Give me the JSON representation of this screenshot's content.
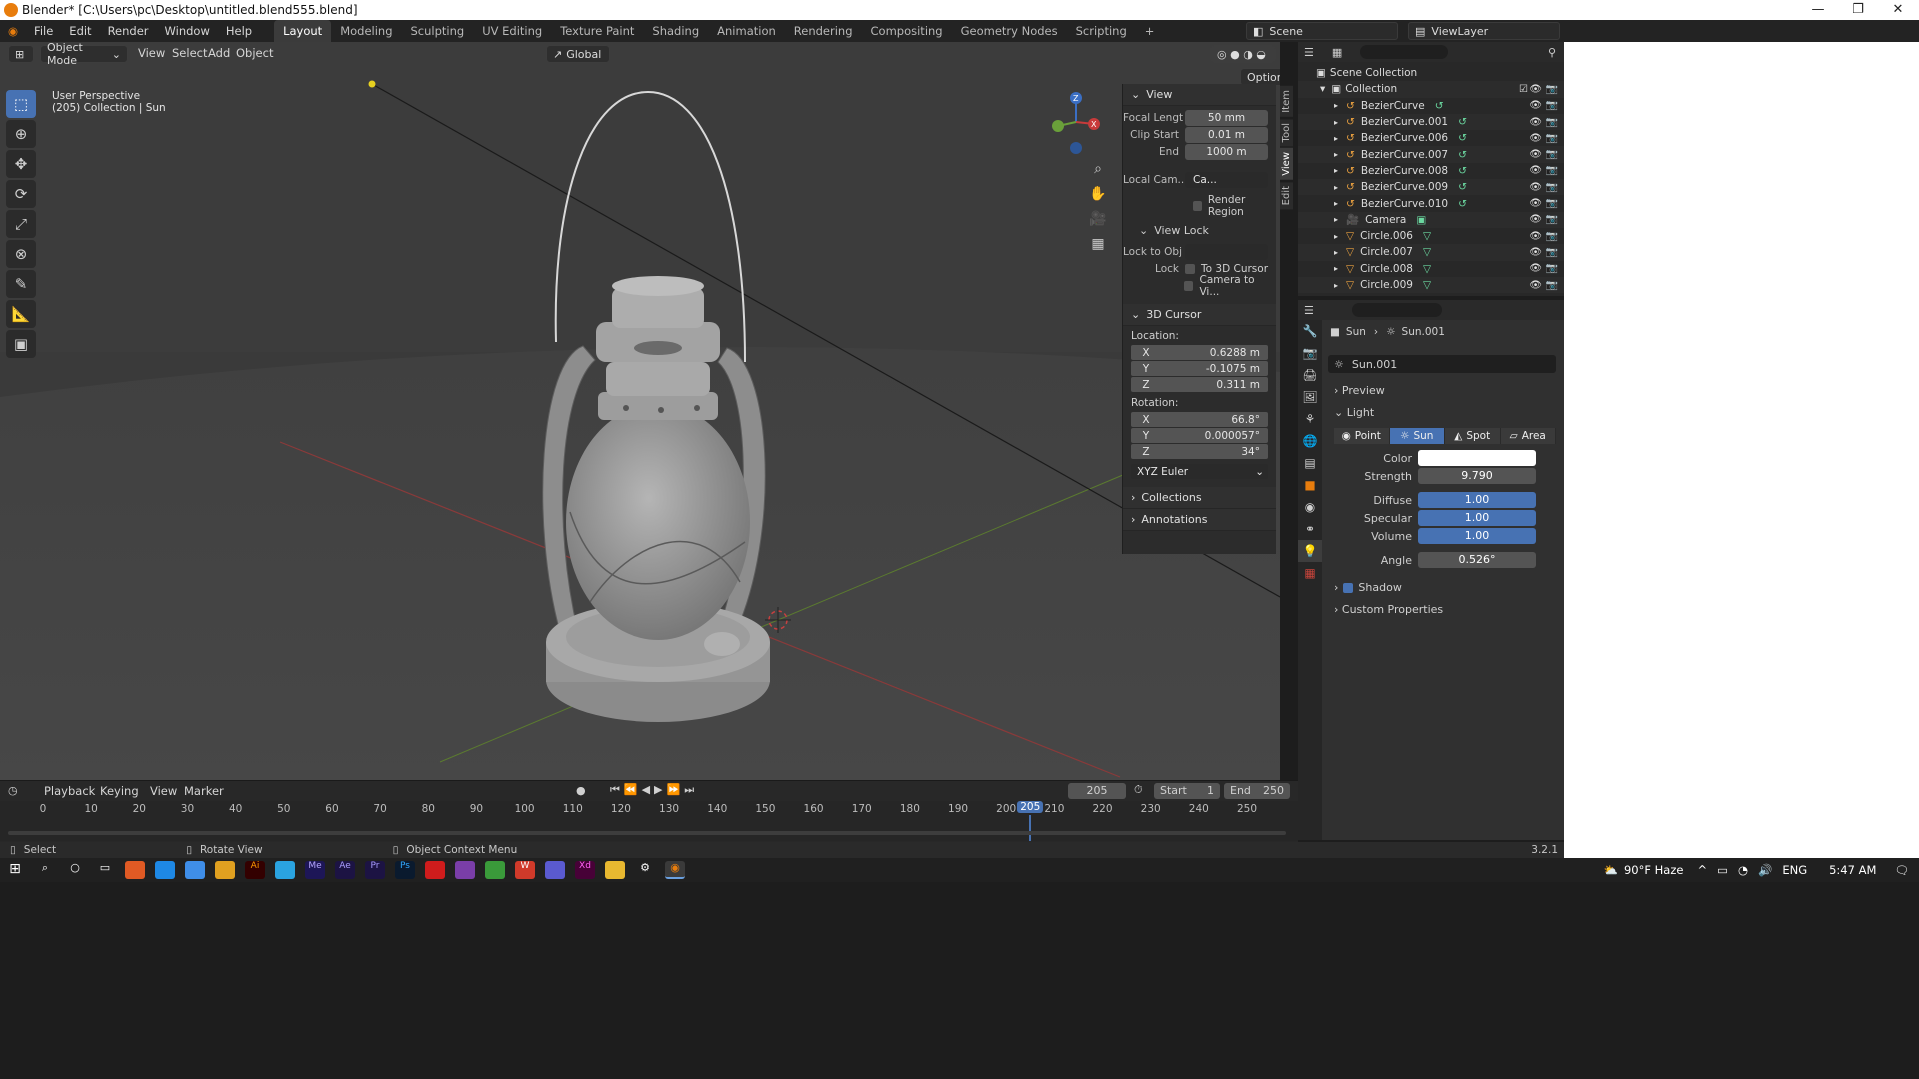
{
  "window": {
    "title": "Blender* [C:\\Users\\pc\\Desktop\\untitled.blend555.blend]"
  },
  "menu": [
    "File",
    "Edit",
    "Render",
    "Window",
    "Help"
  ],
  "workspaces": [
    "Layout",
    "Modeling",
    "Sculpting",
    "UV Editing",
    "Texture Paint",
    "Shading",
    "Animation",
    "Rendering",
    "Compositing",
    "Geometry Nodes",
    "Scripting"
  ],
  "scene": {
    "scene_label": "Scene",
    "viewlayer_label": "ViewLayer"
  },
  "viewport": {
    "mode": "Object Mode",
    "menus": [
      "View",
      "Select",
      "Add",
      "Object"
    ],
    "orientation": "Global",
    "options": "Options",
    "info_line1": "User Perspective",
    "info_line2": "(205) Collection | Sun"
  },
  "npanel": {
    "tabs": [
      "Item",
      "Tool",
      "View",
      "Edit"
    ],
    "view": {
      "title": "View",
      "focal_label": "Focal Lengt",
      "focal_value": "50 mm",
      "clip_start_label": "Clip Start",
      "clip_start_value": "0.01 m",
      "end_label": "End",
      "end_value": "1000 m",
      "local_cam_label": "Local Cam...",
      "local_cam_value": "Ca...",
      "render_region": "Render Region"
    },
    "view_lock": {
      "title": "View Lock",
      "lock_to_obj": "Lock to Obj",
      "lock": "Lock",
      "to_3d_cursor": "To 3D Cursor",
      "camera_to_view": "Camera to Vi..."
    },
    "cursor": {
      "title": "3D Cursor",
      "location_label": "Location:",
      "loc": [
        {
          "axis": "X",
          "value": "0.6288 m"
        },
        {
          "axis": "Y",
          "value": "-0.1075 m"
        },
        {
          "axis": "Z",
          "value": "0.311 m"
        }
      ],
      "rotation_label": "Rotation:",
      "rot": [
        {
          "axis": "X",
          "value": "66.8°"
        },
        {
          "axis": "Y",
          "value": "0.000057°"
        },
        {
          "axis": "Z",
          "value": "34°"
        }
      ],
      "rotation_mode": "XYZ Euler"
    },
    "collections": "Collections",
    "annotations": "Annotations"
  },
  "outliner": {
    "scene_collection": "Scene Collection",
    "collection": "Collection",
    "items": [
      "BezierCurve",
      "BezierCurve.001",
      "BezierCurve.006",
      "BezierCurve.007",
      "BezierCurve.008",
      "BezierCurve.009",
      "BezierCurve.010",
      "Camera",
      "Circle.006",
      "Circle.007",
      "Circle.008",
      "Circle.009"
    ]
  },
  "properties": {
    "breadcrumb_obj": "Sun",
    "breadcrumb_data": "Sun.001",
    "datablock": "Sun.001",
    "preview": "Preview",
    "light": "Light",
    "light_types": [
      "Point",
      "Sun",
      "Spot",
      "Area"
    ],
    "active_type": "Sun",
    "color_label": "Color",
    "strength_label": "Strength",
    "strength": "9.790",
    "diffuse_label": "Diffuse",
    "diffuse": "1.00",
    "specular_label": "Specular",
    "specular": "1.00",
    "volume_label": "Volume",
    "volume": "1.00",
    "angle_label": "Angle",
    "angle": "0.526°",
    "shadow": "Shadow",
    "custom_properties": "Custom Properties"
  },
  "timeline": {
    "menus": [
      "Playback",
      "Keying",
      "View",
      "Marker"
    ],
    "current_frame": "205",
    "start_label": "Start",
    "start": "1",
    "end_label": "End",
    "end": "250",
    "ticks": [
      "0",
      "10",
      "20",
      "30",
      "40",
      "50",
      "60",
      "70",
      "80",
      "90",
      "100",
      "110",
      "120",
      "130",
      "140",
      "150",
      "160",
      "170",
      "180",
      "190",
      "200",
      "210",
      "220",
      "230",
      "240",
      "250"
    ],
    "playhead": "205"
  },
  "status": {
    "select": "Select",
    "rotate_view": "Rotate View",
    "context_menu": "Object Context Menu",
    "version": "3.2.1"
  },
  "taskbar": {
    "weather": "90°F  Haze",
    "language": "ENG",
    "time": "5:47 AM"
  },
  "colors": {
    "accent": "#4772b3",
    "orange": "#e87d0d",
    "viewport_bg": "#3a3a3a"
  }
}
